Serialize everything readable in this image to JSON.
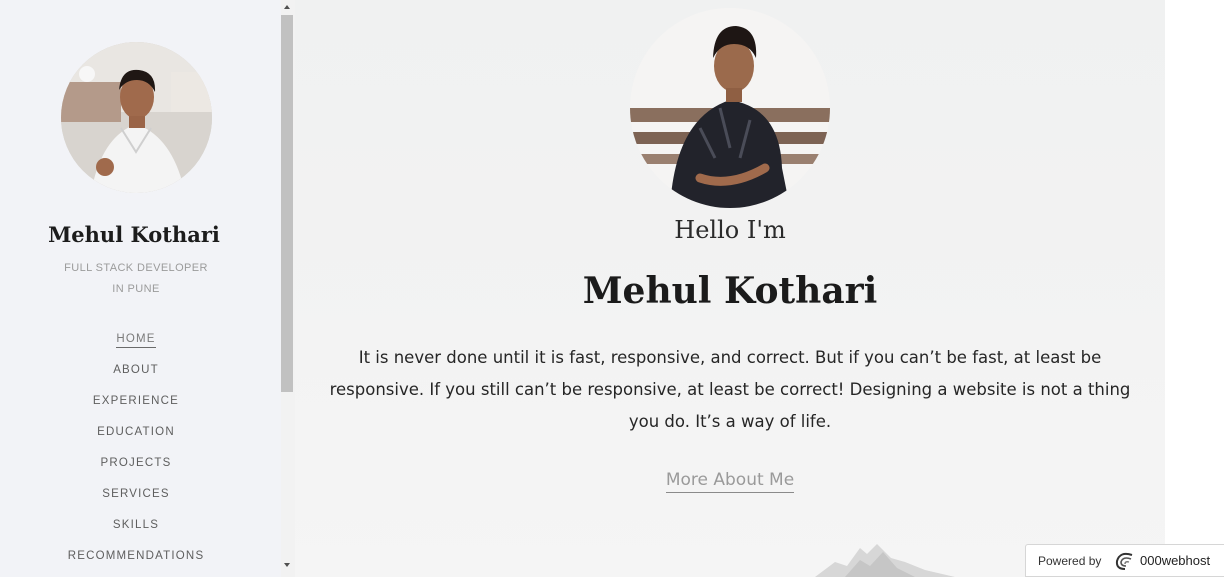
{
  "sidebar": {
    "name": "Mehul Kothari",
    "subtitle_line1": "FULL STACK DEVELOPER",
    "subtitle_line2": "IN PUNE",
    "nav": [
      {
        "label": "HOME",
        "active": true
      },
      {
        "label": "ABOUT"
      },
      {
        "label": "EXPERIENCE"
      },
      {
        "label": "EDUCATION"
      },
      {
        "label": "PROJECTS"
      },
      {
        "label": "SERVICES"
      },
      {
        "label": "SKILLS"
      },
      {
        "label": "RECOMMENDATIONS"
      }
    ]
  },
  "hero": {
    "greeting": "Hello I'm",
    "name": "Mehul Kothari",
    "tagline": "It is never done until it is fast, responsive, and correct. But if you can’t be fast, at least be responsive. If you still can’t be responsive, at least be correct! Designing a website is not a thing you do. It’s a way of life.",
    "cta_label": "More About Me"
  },
  "badge": {
    "label": "Powered by",
    "brand": "000webhost",
    "icon": "000webhost-swirl-icon"
  }
}
